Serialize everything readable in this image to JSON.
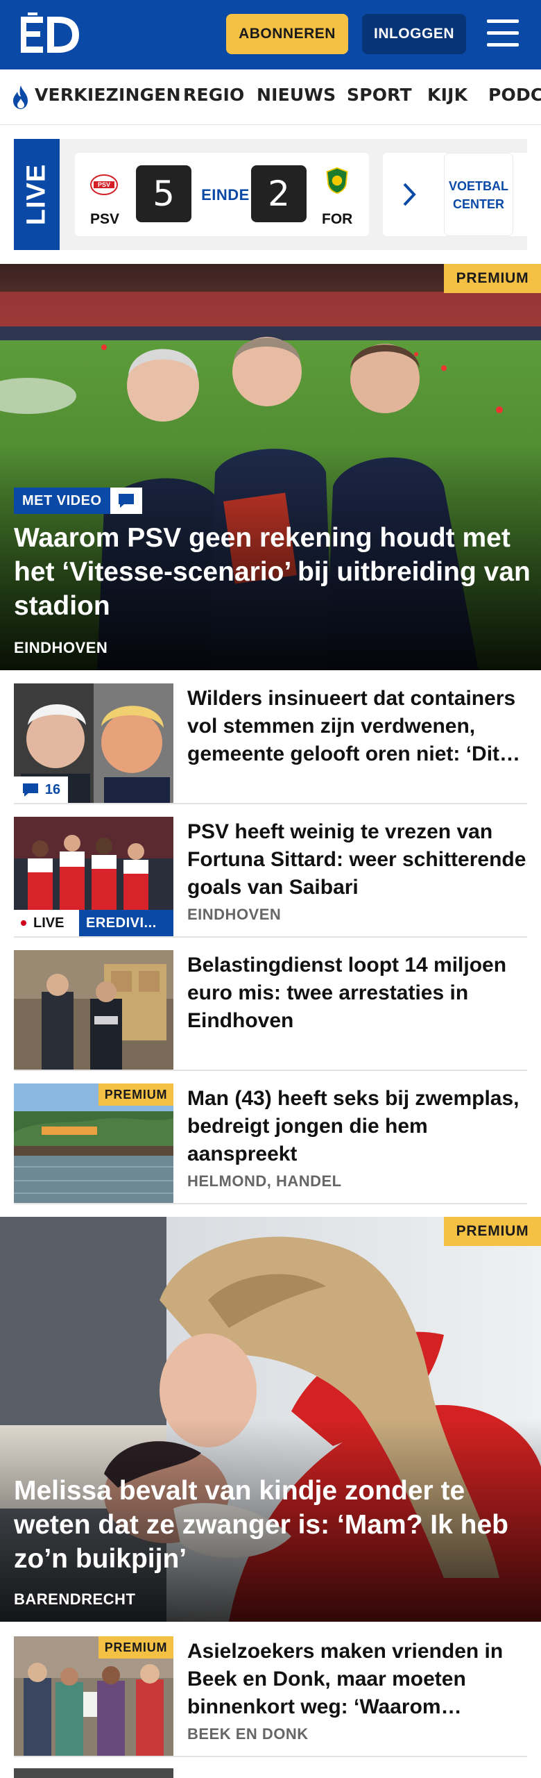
{
  "header": {
    "subscribe_label": "ABONNEREN",
    "login_label": "INLOGGEN",
    "brand_color": "#0a4aa6",
    "accent_color": "#f4c144"
  },
  "nav": {
    "items": [
      "VERKIEZINGEN",
      "REGIO",
      "NIEUWS",
      "SPORT",
      "KIJK",
      "PODCAST"
    ]
  },
  "live_score": {
    "live_label": "LIVE",
    "home_team": "PSV",
    "home_score": "5",
    "status": "EINDE",
    "away_score": "2",
    "away_team": "FOR",
    "link_label_line1": "VOETBAL",
    "link_label_line2": "CENTER"
  },
  "hero1": {
    "premium_label": "PREMIUM",
    "video_label": "MET VIDEO",
    "title": "Waarom PSV geen rekening houdt met het ‘Vitesse-scenario’ bij uitbreiding van stadion",
    "location": "EINDHOVEN"
  },
  "articles": [
    {
      "title": "Wilders insinueert dat containers vol stemmen zijn verdwenen, gemeente gelooft oren niet: ‘Dit…",
      "comments": "16"
    },
    {
      "title": "PSV heeft weinig te vrezen van Fortuna Sittard: weer schitteren­de goals van Saibari",
      "location": "EINDHOVEN",
      "live_label": "LIVE",
      "category_label": "EREDIVI..."
    },
    {
      "title": "Belastingdienst loopt 14 miljoen euro mis: twee arrestaties in Eindhoven"
    },
    {
      "title": "Man (43) heeft seks bij zwemplas, bedreigt jongen die hem aanspreekt",
      "location": "HELMOND, HANDEL",
      "premium_label": "PREMIUM"
    }
  ],
  "hero2": {
    "premium_label": "PREMIUM",
    "title": "Melissa bevalt van kindje zonder te weten dat ze zwanger is: ‘Mam? Ik heb zo’n buikpijn’",
    "location": "BARENDRECHT"
  },
  "article5": {
    "title": "Asielzoekers maken vrienden in Beek en Donk, maar moeten binnenkort weg: ‘Waarom…",
    "location": "BEEK EN DONK",
    "premium_label": "PREMIUM"
  }
}
